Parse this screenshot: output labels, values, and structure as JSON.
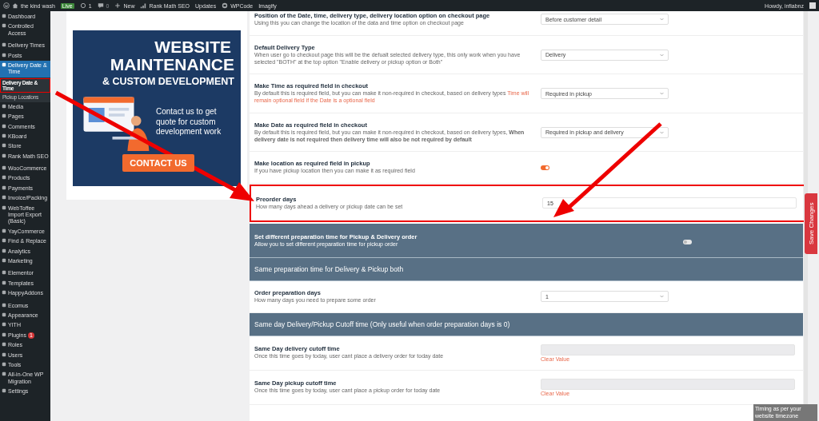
{
  "admin_bar": {
    "site": "the kind wash",
    "live_badge": "Live",
    "updates_count": "1",
    "comments_count": "0",
    "new": "New",
    "items": [
      "Rank Math SEO",
      "Updates",
      "WPCode",
      "Imagify"
    ],
    "greeting": "Howdy, infiabnz"
  },
  "sidebar": {
    "groups": [
      [
        {
          "label": "Dashboard",
          "selected": false
        },
        {
          "label": "Controlled Access",
          "selected": false
        }
      ],
      [
        {
          "label": "Delivery Times",
          "selected": false
        },
        {
          "label": "Posts",
          "selected": false
        },
        {
          "label": "Delivery Date & Time",
          "selected": true,
          "children": [
            {
              "label": "Delivery Date & Time",
              "selected": true,
              "highlighted": true
            },
            {
              "label": "Pickup Locations",
              "selected": false,
              "highlighted": false
            }
          ]
        },
        {
          "label": "Media",
          "selected": false
        },
        {
          "label": "Pages",
          "selected": false
        },
        {
          "label": "Comments",
          "selected": false
        },
        {
          "label": "KBoard",
          "selected": false
        },
        {
          "label": "Store",
          "selected": false
        },
        {
          "label": "Rank Math SEO",
          "selected": false
        }
      ],
      [
        {
          "label": "WooCommerce",
          "selected": false
        },
        {
          "label": "Products",
          "selected": false
        },
        {
          "label": "Payments",
          "selected": false
        },
        {
          "label": "Invoice/Packing",
          "selected": false
        },
        {
          "label": "WebToffee Import Export (Basic)",
          "selected": false
        },
        {
          "label": "YayCommerce",
          "selected": false
        },
        {
          "label": "Find & Replace",
          "selected": false
        },
        {
          "label": "Analytics",
          "selected": false
        },
        {
          "label": "Marketing",
          "selected": false
        }
      ],
      [
        {
          "label": "Elementor",
          "selected": false
        },
        {
          "label": "Templates",
          "selected": false
        },
        {
          "label": "HappyAddons",
          "selected": false
        }
      ],
      [
        {
          "label": "Ecomus",
          "selected": false
        },
        {
          "label": "Appearance",
          "selected": false
        },
        {
          "label": "YITH",
          "selected": false
        },
        {
          "label": "Plugins",
          "selected": false,
          "badge": "1"
        },
        {
          "label": "Roles",
          "selected": false
        },
        {
          "label": "Users",
          "selected": false
        },
        {
          "label": "Tools",
          "selected": false
        },
        {
          "label": "All-in-One WP Migration",
          "selected": false
        },
        {
          "label": "Settings",
          "selected": false
        }
      ]
    ]
  },
  "promo": {
    "title_lines": [
      "WEBSITE",
      "MAINTENANCE"
    ],
    "subtitle": "& CUSTOM DEVELOPMENT",
    "text": "Contact us to get quote for custom development work",
    "button": "CONTACT US"
  },
  "settings": [
    {
      "kind": "select",
      "title": "Position of the Date, time, delivery type, delivery location option on checkout page",
      "description": "Using this you can change the location of the data and time option on checkout page",
      "value": "Before customer detail",
      "highlighted": false
    },
    {
      "kind": "select",
      "title": "Default Delivery Type",
      "description": "When user go to checkout page this will be the defualt selected delivery type, this only work when you have selected \"BOTH\" at the top option \"Enable delivery or pickup option or Both\"",
      "value": "Delivery",
      "highlighted": false
    },
    {
      "kind": "select",
      "title": "Make Time as required field in checkout",
      "description": "By default this is required field, but you can make it non-required in checkout, based on delivery types",
      "note": "Time will remain optional field if the Date is a optional field",
      "value": "Required in pickup",
      "highlighted": false
    },
    {
      "kind": "select",
      "title": "Make Date as required field in checkout",
      "description": "By default this is required field, but you can make it non-required in checkout, based on delivery types, **When delivery date is not required then delivery time will also be not required by default**",
      "value": "Required in pickup and delivery",
      "highlighted": false
    },
    {
      "kind": "toggle",
      "title": "Make location as required field in pickup",
      "description": "If you have pickup location then you can make it as required field",
      "on": true,
      "highlighted": false
    },
    {
      "kind": "input",
      "title": "Preorder days",
      "description": "How many days ahead a delivery or pickup date can be set",
      "value": "15",
      "highlighted": true
    },
    {
      "kind": "header_toggle",
      "title": "Set different preparation time for Pickup & Delivery order",
      "description": "Allow you to set different preparation time for pickup order",
      "on": false
    },
    {
      "kind": "header",
      "title": "Same preparation time for Delivery & Pickup both"
    },
    {
      "kind": "select",
      "title": "Order preparation days",
      "description": "How many days you need to prepare some order",
      "value": "1",
      "highlighted": false
    },
    {
      "kind": "header",
      "title": "Same day Delivery/Pickup Cutoff time (Only useful when order preparation days is 0)"
    },
    {
      "kind": "time",
      "title": "Same Day delivery cutoff time",
      "description": "Once this time goes by today, user cant place a delivery order for today date",
      "link": "Clear Value",
      "highlighted": false
    },
    {
      "kind": "time",
      "title": "Same Day pickup cutoff time",
      "description": "Once this time goes by today, user cant place a pickup order for today date",
      "link": "Clear Value",
      "highlighted": false
    }
  ],
  "save_button": "Save Changes",
  "tooltip": "Timing as per your website timezone"
}
